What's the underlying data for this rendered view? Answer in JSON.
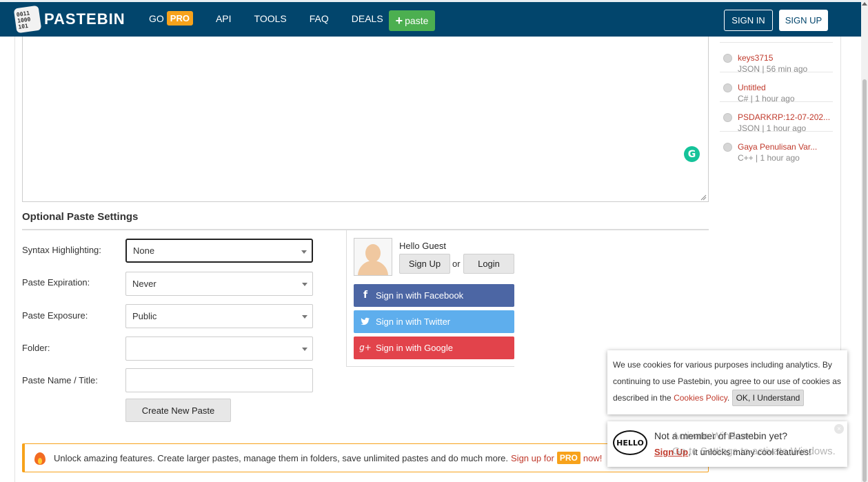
{
  "header": {
    "logo_text": "PASTEBIN",
    "logo_mark_lines": [
      "0011",
      "1000",
      "101"
    ],
    "nav": {
      "go_label": "GO",
      "pro_label": "PRO",
      "api_label": "API",
      "tools_label": "TOOLS",
      "faq_label": "FAQ",
      "deals_label": "DEALS"
    },
    "paste_button": "paste",
    "sign_in": "SIGN IN",
    "sign_up": "SIGN UP"
  },
  "recent_pastes": [
    {
      "title": "keys3715",
      "meta": "JSON | 56 min ago"
    },
    {
      "title": "Untitled",
      "meta": "C# | 1 hour ago"
    },
    {
      "title": "PSDARKRP:12-07-202...",
      "meta": "JSON | 1 hour ago"
    },
    {
      "title": "Gaya Penulisan Var...",
      "meta": "C++ | 1 hour ago"
    }
  ],
  "editor": {
    "grammarly_icon": "G"
  },
  "settings": {
    "title": "Optional Paste Settings",
    "syntax_label": "Syntax Highlighting:",
    "syntax_value": "None",
    "expiration_label": "Paste Expiration:",
    "expiration_value": "Never",
    "exposure_label": "Paste Exposure:",
    "exposure_value": "Public",
    "folder_label": "Folder:",
    "folder_value": "",
    "name_label": "Paste Name / Title:",
    "name_value": "",
    "create_button": "Create New Paste"
  },
  "guest": {
    "hello": "Hello",
    "guest_name": "Guest",
    "sign_up_button": "Sign Up",
    "or_text": "or",
    "login_button": "Login",
    "facebook": "Sign in with Facebook",
    "twitter": "Sign in with Twitter",
    "google": "Sign in with Google"
  },
  "pro_banner": {
    "text": "Unlock amazing features. Create larger pastes, manage them in folders, save unlimited pastes and do much more.",
    "signup_text": "Sign up for",
    "pro_label": "PRO",
    "now_text": "now!"
  },
  "cookie_popup": {
    "text_part1": "We use cookies for various purposes including analytics. By continuing to use Pastebin, you agree to our use of cookies as described in the",
    "link_text": "Cookies Policy",
    "text_part2": ".",
    "ok_button": "OK, I Understand"
  },
  "member_popup": {
    "bubble_text": "HELLO",
    "line1": "Not a member of Pastebin yet?",
    "signup_link": "Sign Up",
    "line2_rest": ", it unlocks many cool features!",
    "close": "×"
  },
  "watermark": {
    "line1": "Activate Windows",
    "line2": "Go to Settings to activate Windows."
  },
  "colors": {
    "header_bg": "#02456c",
    "pro_orange": "#f7a21b",
    "paste_green": "#4caf50",
    "link_red": "#c0392b",
    "facebook": "#4c66a4",
    "twitter": "#5eaeed",
    "google": "#e2434b"
  }
}
